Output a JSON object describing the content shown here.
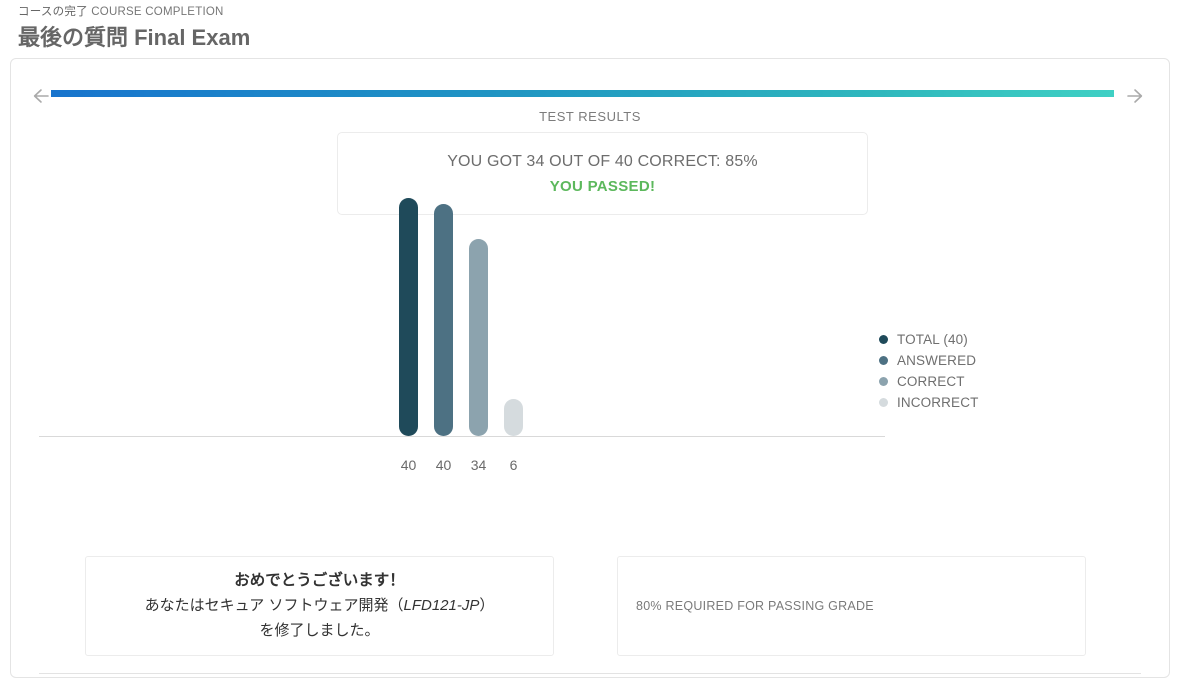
{
  "header": {
    "eyebrow_jp": "コースの完了",
    "eyebrow_en": "COURSE COMPLETION",
    "title": "最後の質問 Final Exam"
  },
  "nav": {
    "prev_label": "previous",
    "next_label": "next"
  },
  "progress": {
    "percent": 100,
    "gradient_start": "#1874cd",
    "gradient_end": "#3fd0c4"
  },
  "results": {
    "section_label": "TEST RESULTS",
    "summary": "YOU GOT 34 OUT OF 40 CORRECT: 85%",
    "status": "YOU PASSED!",
    "status_color": "#5cb85c"
  },
  "chart_data": {
    "type": "bar",
    "title": "TEST RESULTS",
    "categories": [
      "TOTAL (40)",
      "ANSWERED",
      "CORRECT",
      "INCORRECT"
    ],
    "values": [
      40,
      40,
      34,
      6
    ],
    "value_labels": [
      "40",
      "40",
      "34",
      "6"
    ],
    "colors": [
      "#1f4a5a",
      "#4d7183",
      "#8ca3ae",
      "#d5dbde"
    ],
    "xlabel": "",
    "ylabel": "",
    "ylim": [
      0,
      40
    ],
    "grid": false,
    "legend_position": "right",
    "legend": [
      {
        "label": "TOTAL (40)",
        "color": "#1f4a5a"
      },
      {
        "label": "ANSWERED",
        "color": "#4d7183"
      },
      {
        "label": "CORRECT",
        "color": "#8ca3ae"
      },
      {
        "label": "INCORRECT",
        "color": "#d5dbde"
      }
    ]
  },
  "congratulations": {
    "title": "おめでとうございます！",
    "line1_pre": "あなたはセキュア ソフトウェア開発（",
    "line1_course_code": "LFD121-JP",
    "line1_post": "）",
    "line2": "を修了しました。"
  },
  "requirement": {
    "text": "80% REQUIRED FOR PASSING GRADE"
  }
}
